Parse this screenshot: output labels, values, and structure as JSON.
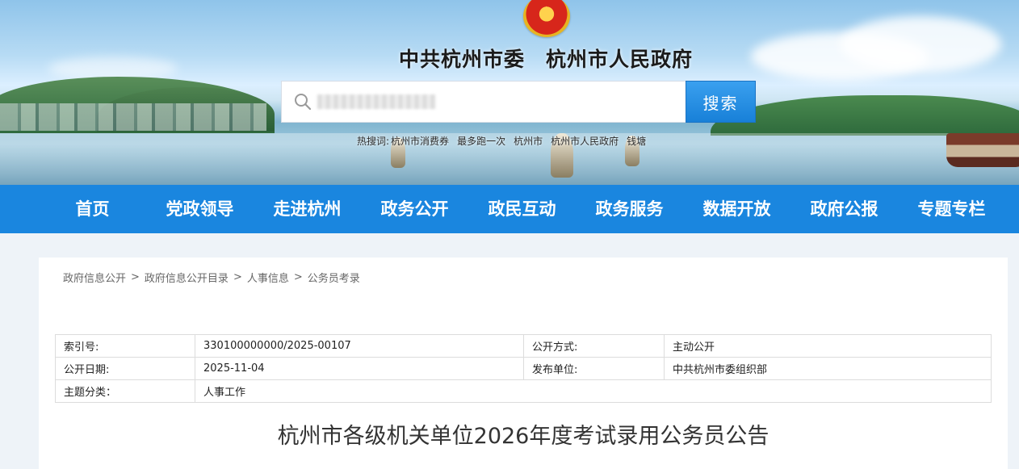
{
  "header": {
    "site_title": "中共杭州市委　杭州市人民政府",
    "emblem": "national-emblem"
  },
  "search": {
    "placeholder": "",
    "button_label": "搜索",
    "hot_words": [
      "热搜词:",
      "杭州市消费券",
      "最多跑一次",
      "杭州市",
      "杭州市人民政府",
      "钱塘"
    ]
  },
  "nav": {
    "items": [
      "首页",
      "党政领导",
      "走进杭州",
      "政务公开",
      "政民互动",
      "政务服务",
      "数据开放",
      "政府公报",
      "专题专栏"
    ]
  },
  "breadcrumb": {
    "items": [
      "政府信息公开",
      "政府信息公开目录",
      "人事信息",
      "公务员考录"
    ],
    "separator": ">"
  },
  "info": {
    "index_label": "索引号:",
    "index_value": "330100000000/2025-00107",
    "method_label": "公开方式:",
    "method_value": "主动公开",
    "date_label": "公开日期:",
    "date_value": "2025-11-04",
    "publisher_label": "发布单位:",
    "publisher_value": "中共杭州市委组织部",
    "category_label": "主题分类：",
    "category_value": "人事工作"
  },
  "article": {
    "title": "杭州市各级机关单位2026年度考试录用公务员公告"
  },
  "colors": {
    "nav_bg": "#1a86df",
    "search_button": "#1f8ae0",
    "page_bg": "#eef3f8"
  }
}
